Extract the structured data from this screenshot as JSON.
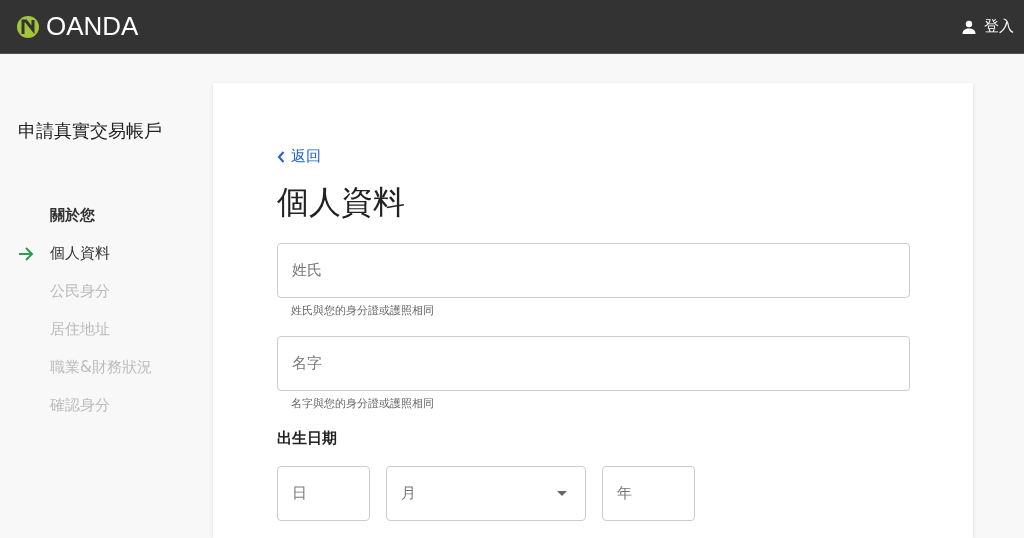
{
  "header": {
    "logo_text": "OANDA",
    "login": "登入"
  },
  "sidebar": {
    "title": "申請真實交易帳戶",
    "steps": [
      {
        "label": "關於您",
        "kind": "section",
        "selected": false
      },
      {
        "label": "個人資料",
        "kind": "step",
        "selected": true
      },
      {
        "label": "公民身分",
        "kind": "step",
        "selected": false
      },
      {
        "label": "居住地址",
        "kind": "step",
        "selected": false
      },
      {
        "label": "職業&財務狀況",
        "kind": "step",
        "selected": false
      },
      {
        "label": "確認身分",
        "kind": "step",
        "selected": false
      }
    ]
  },
  "form": {
    "back": "返回",
    "title": "個人資料",
    "fields": [
      {
        "placeholder": "姓氏",
        "hint": "姓氏與您的身分證或護照相同"
      },
      {
        "placeholder": "名字",
        "hint": "名字與您的身分證或護照相同"
      }
    ],
    "birth_label": "出生日期",
    "birth_fields": [
      {
        "kind": "input",
        "placeholder": "日"
      },
      {
        "kind": "select",
        "placeholder": "月"
      },
      {
        "kind": "input",
        "placeholder": "年"
      }
    ]
  }
}
